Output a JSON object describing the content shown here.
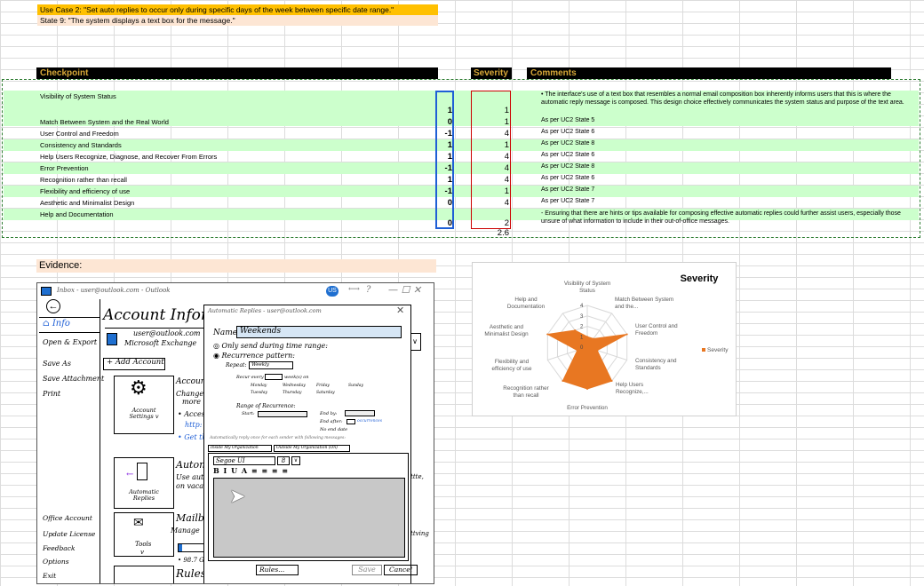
{
  "use_case": {
    "title": "Use Case 2: \"Set auto replies to occur only during specific days of the week between specific date range.\"",
    "state": "State 9: \"The system displays a text box for the message.\""
  },
  "headers": {
    "checkpoint": "Checkpoint",
    "severity": "Severity",
    "comments": "Comments"
  },
  "rows": [
    {
      "label": "Visibility of System Status",
      "score": "1",
      "severity": "1",
      "comment": "• The interface's use of a text box that resembles a normal email composition box inherently informs users that this is where the automatic reply message is composed. This design choice effectively communicates the system status and purpose of the text area."
    },
    {
      "label": "Match Between System and the Real World",
      "score": "0",
      "severity": "1",
      "comment": "As per UC2 State 5"
    },
    {
      "label": "User Control and Freedom",
      "score": "-1",
      "severity": "4",
      "comment": "As per UC2 State 6"
    },
    {
      "label": "Consistency and Standards",
      "score": "1",
      "severity": "1",
      "comment": "As per UC2 State 8"
    },
    {
      "label": "Help Users Recognize, Diagnose, and Recover From Errors",
      "score": "1",
      "severity": "4",
      "comment": "As per UC2 State 6"
    },
    {
      "label": "Error Prevention",
      "score": "-1",
      "severity": "4",
      "comment": "As per UC2 State 8"
    },
    {
      "label": "Recognition rather than recall",
      "score": "1",
      "severity": "4",
      "comment": "As per UC2 State 6"
    },
    {
      "label": "Flexibility and efficiency of use",
      "score": "-1",
      "severity": "1",
      "comment": "As per UC2 State 7"
    },
    {
      "label": "Aesthetic and Minimalist Design",
      "score": "0",
      "severity": "4",
      "comment": "As per UC2 State 7"
    },
    {
      "label": "Help and Documentation",
      "score": "0",
      "severity": "2",
      "comment": "- Ensuring that there are hints or tips available for composing effective automatic replies could further assist users, especially those unsure of what information to include in their out-of-office messages."
    }
  ],
  "severity_avg": "2.6",
  "evidence_label": "Evidence:",
  "sketch": {
    "titlebar": "Inbox - user@outlook.com - Outlook",
    "user_badge": "US",
    "help": "?",
    "menu": [
      "Info",
      "Open & Export",
      "Save As",
      "Save Attachment",
      "Print"
    ],
    "menu_bottom": [
      "Office Account",
      "Update License",
      "Feedback",
      "Options",
      "Exit"
    ],
    "heading": "Account Informa",
    "account_email": "user@outlook.com",
    "account_type": "Microsoft Exchange",
    "add_account": "+ Add Account",
    "account_settings": "Account Settings",
    "account_caret": "v",
    "acc_head": "Accoun",
    "acc_l1": "Change",
    "acc_l2": "more",
    "acc_l3": "• Access",
    "acc_l4": "http:",
    "acc_l5": "• Get th",
    "auto_replies": "Automatic Replies",
    "auto_head": "Autom",
    "auto_l1": "Use aut",
    "auto_l2": "on vaca",
    "tools": "Tools",
    "tools_caret": "v",
    "mail_head": "Mailb",
    "mail_l1": "Manage",
    "mail_l2": "• 98.7 GB",
    "rules_head": "Rules",
    "right_l1": "ttte,",
    "right_l2": "ttving",
    "dialog": {
      "title": "Automatic Replies - user@outlook.com",
      "name_label": "Name:",
      "name_value": "Weekends",
      "opt1": "Only send during time range:",
      "opt2": "Recurrence pattern:",
      "repeat_label": "Repeat:",
      "repeat_value": "Weekly",
      "recur_label": "Recur every",
      "recur_suffix": "week(s) on",
      "day_1": "Monday",
      "day_2": "Tuesday",
      "day_3": "Wednesday",
      "day_4": "Thursday",
      "day_5": "Friday",
      "day_6": "Saturday",
      "day_7": "Sunday",
      "range_label": "Range of Recurrence:",
      "start_label": "Start:",
      "end_by": "End by:",
      "end_after": "End after:",
      "occurrences": "occurrences",
      "no_end": "No end date",
      "note": "Automatically reply once for each sender with following messages:",
      "tab1": "Inside My Organization",
      "tab2": "Outside My Organization (On)",
      "font": "Segoe UI",
      "size": "8",
      "format_icons": "B I U A ≡ ≡ ≡ ≡",
      "rules_btn": "Rules...",
      "save_btn": "Save",
      "cancel_btn": "Cancel"
    }
  },
  "chart_data": {
    "type": "radar",
    "title": "Severity",
    "legend": "Severity",
    "legend_position": "right",
    "range": [
      0,
      4
    ],
    "ticks": [
      "0",
      "1",
      "2",
      "3",
      "4"
    ],
    "categories": [
      "Visibility of System Status",
      "Match Between System and the...",
      "User Control and Freedom",
      "Consistency and Standards",
      "Help Users Recognize,...",
      "Error Prevention",
      "Recognition rather than recall",
      "Flexibility and efficiency of use",
      "Aesthetic and Minimalist Design",
      "Help and Documentation"
    ],
    "values": [
      1,
      1,
      4,
      1,
      4,
      4,
      4,
      1,
      4,
      2
    ],
    "color": "#e87722"
  }
}
